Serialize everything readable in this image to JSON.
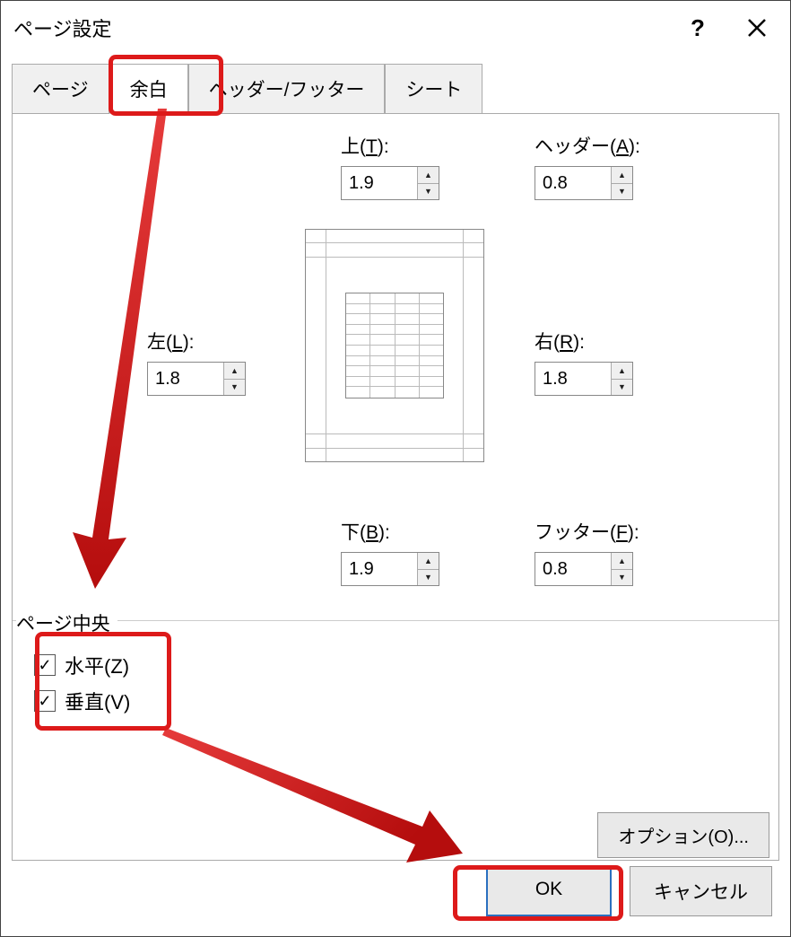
{
  "window": {
    "title": "ページ設定"
  },
  "tabs": {
    "page": "ページ",
    "margins": "余白",
    "headerFooter": "ヘッダー/フッター",
    "sheet": "シート"
  },
  "margins": {
    "top": {
      "label": "上(",
      "accel": "T",
      "suffix": "):",
      "value": "1.9"
    },
    "header": {
      "label": "ヘッダー(",
      "accel": "A",
      "suffix": "):",
      "value": "0.8"
    },
    "left": {
      "label": "左(",
      "accel": "L",
      "suffix": "):",
      "value": "1.8"
    },
    "right": {
      "label": "右(",
      "accel": "R",
      "suffix": "):",
      "value": "1.8"
    },
    "bottom": {
      "label": "下(",
      "accel": "B",
      "suffix": "):",
      "value": "1.9"
    },
    "footer": {
      "label": "フッター(",
      "accel": "F",
      "suffix": "):",
      "value": "0.8"
    }
  },
  "center": {
    "section": "ページ中央",
    "horizontal": {
      "label": "水平(",
      "accel": "Z",
      "suffix": ")",
      "checked": true
    },
    "vertical": {
      "label": "垂直(",
      "accel": "V",
      "suffix": ")",
      "checked": true
    }
  },
  "buttons": {
    "options": {
      "label": "オプション(",
      "accel": "O",
      "suffix": ")..."
    },
    "ok": "OK",
    "cancel": "キャンセル"
  }
}
